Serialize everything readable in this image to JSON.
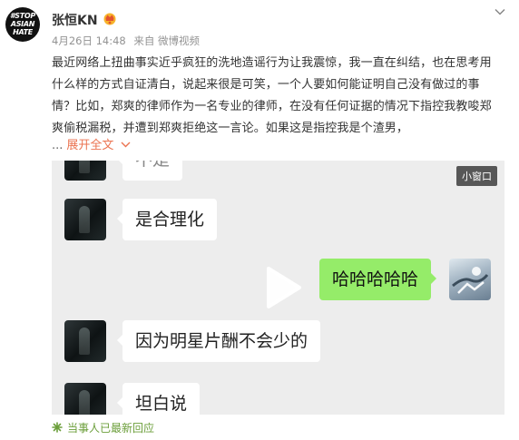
{
  "post": {
    "avatar_text": [
      "#STOP",
      "ASIAN",
      "HATE"
    ],
    "username": "张恒KN",
    "badge_icon": "vip-crown-icon",
    "date": "4月26日 14:48",
    "source": "来自 微博视频",
    "content": "最近网络上扭曲事实近乎疯狂的洗地造谣行为让我震惊，我一直在纠结，也在思考用什么样的方式自证清白，说起来很是可笑，一个人要如何能证明自己没有做过的事情？比如，郑爽的律师作为一名专业的律师，在没有任何证据的情况下指控我教唆郑爽偷税漏税，并遭到郑爽拒绝这一言论。如果这是指控我是个渣男，",
    "expand_dots": "...",
    "expand_label": "展开全文",
    "expand_icon": "chevron-down-icon",
    "menu_icon": "chevron-down-icon"
  },
  "video": {
    "mini_window_label": "小窗口",
    "play_icon": "play-icon",
    "messages": [
      {
        "side": "left",
        "text": "不是"
      },
      {
        "side": "left",
        "text": "是合理化"
      },
      {
        "side": "right",
        "text": "哈哈哈哈哈"
      },
      {
        "side": "left",
        "text": "因为明星片酬不会少的"
      },
      {
        "side": "left",
        "text": "坦白说"
      }
    ]
  },
  "footer": {
    "reply_icon": "sparkle-icon",
    "reply_text": "当事人已最新回应"
  },
  "colors": {
    "link": "#eb7350",
    "bubble_green": "#95ec69",
    "reply_green": "#6b9e3a"
  }
}
